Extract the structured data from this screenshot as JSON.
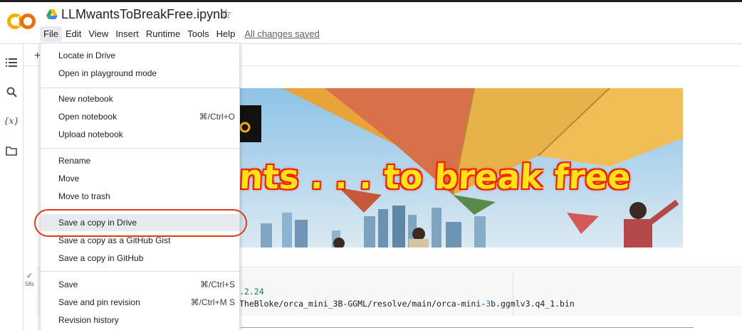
{
  "colors": {
    "accent_orange": "#f9ab00",
    "ring_red": "#e0391a",
    "check_green": "#188038"
  },
  "header": {
    "logo_text": "CO",
    "title": "LLMwantsToBreakFree.ipynb",
    "star_icon": "star-outline-icon",
    "drive_icon": "google-drive-icon"
  },
  "menu": {
    "items": [
      "File",
      "Edit",
      "View",
      "Insert",
      "Runtime",
      "Tools",
      "Help"
    ],
    "active": "File",
    "saved_status": "All changes saved"
  },
  "rail": {
    "icons": [
      "table-of-contents-icon",
      "search-icon",
      "variables-icon",
      "folder-icon"
    ],
    "variables_glyph": "{x}"
  },
  "toolbar": {
    "add_glyph": "+"
  },
  "file_menu": {
    "groups": [
      [
        {
          "label": "Locate in Drive",
          "shortcut": ""
        },
        {
          "label": "Open in playground mode",
          "shortcut": ""
        }
      ],
      [
        {
          "label": "New notebook",
          "shortcut": ""
        },
        {
          "label": "Open notebook",
          "shortcut": "⌘/Ctrl+O"
        },
        {
          "label": "Upload notebook",
          "shortcut": ""
        }
      ],
      [
        {
          "label": "Rename",
          "shortcut": ""
        },
        {
          "label": "Move",
          "shortcut": ""
        },
        {
          "label": "Move to trash",
          "shortcut": ""
        }
      ],
      [
        {
          "label": "Save a copy in Drive",
          "shortcut": ""
        },
        {
          "label": "Save a copy as a GitHub Gist",
          "shortcut": ""
        },
        {
          "label": "Save a copy in GitHub",
          "shortcut": ""
        }
      ],
      [
        {
          "label": "Save",
          "shortcut": "⌘/Ctrl+S"
        },
        {
          "label": "Save and pin revision",
          "shortcut": "⌘/Ctrl+M S"
        },
        {
          "label": "Revision history",
          "shortcut": ""
        }
      ]
    ],
    "highlighted": "Save a copy in Drive"
  },
  "banner": {
    "text": "nts . . . to break free"
  },
  "code_cell": {
    "status_check": "✓",
    "run_time": "58s",
    "line1": ".2.24",
    "line2_before": "TheBloke/orca_mini_3B-GGML/resolve/main/orca-mini-",
    "line2_num": "3",
    "line2_after": "b.ggmlv3.q4_1.bin"
  }
}
